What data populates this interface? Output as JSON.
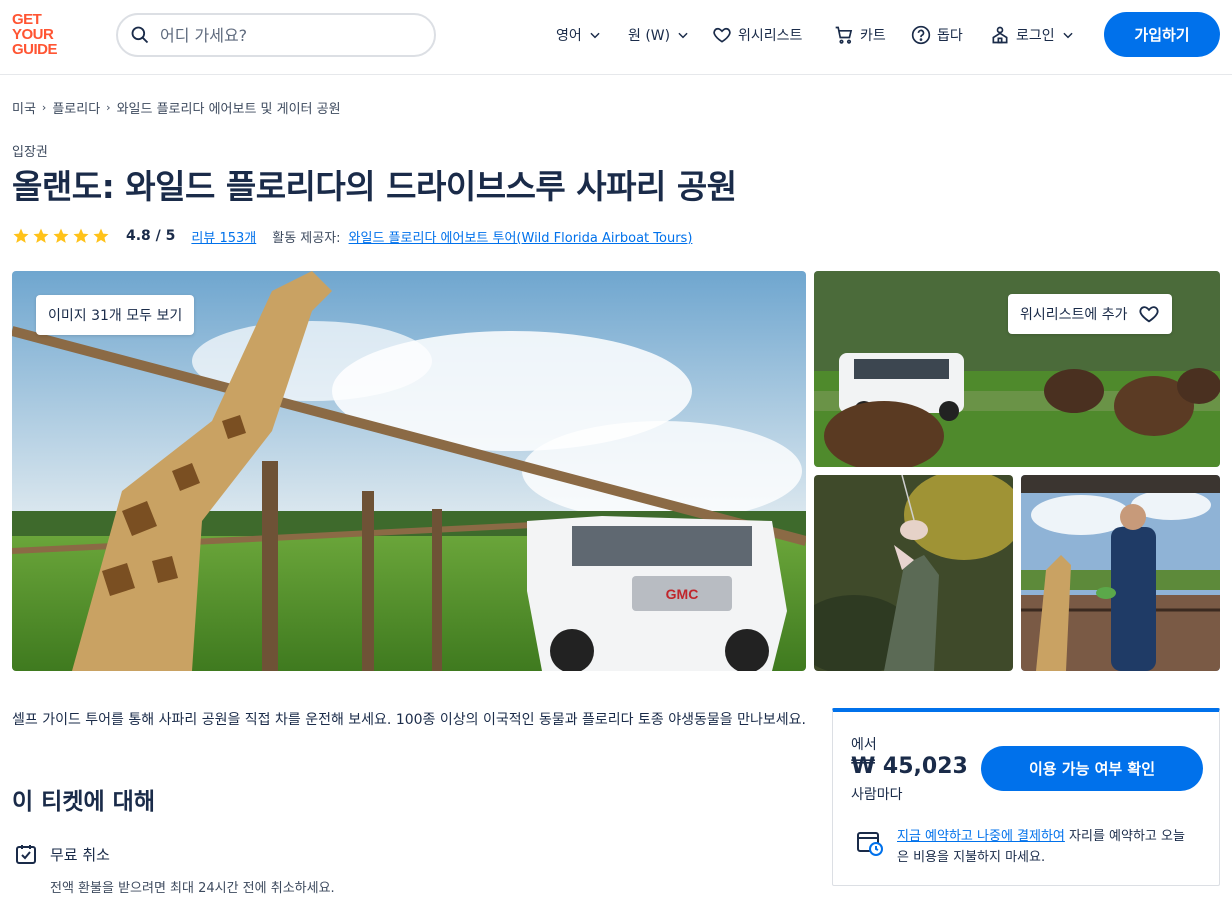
{
  "header": {
    "logo_lines": [
      "GET",
      "YOUR",
      "GUIDE"
    ],
    "search_placeholder": "어디 가세요?",
    "language": "영어",
    "currency": "원 (W)",
    "wishlist": "위시리스트",
    "cart": "카트",
    "help": "돕다",
    "login": "로그인",
    "signup": "가입하기"
  },
  "breadcrumb": [
    "미국",
    "플로리다",
    "와일드 플로리다 에어보트 및 게이터 공원"
  ],
  "product": {
    "category": "입장권",
    "title": "올랜도: 와일드 플로리다의 드라이브스루 사파리 공원",
    "rating_stars": 5,
    "rating": "4.8 / 5",
    "reviews": "리뷰 153개",
    "provider_label": "활동 제공자:",
    "provider": "와일드 플로리다 에어보트 투어(Wild Florida Airboat Tours)"
  },
  "gallery": {
    "view_all": "이미지 31개 모두 보기",
    "add_wishlist": "위시리스트에 추가"
  },
  "content": {
    "description": "셀프 가이드 투어를 통해 사파리 공원을 직접 차를 운전해 보세요. 100종 이상의 이국적인 동물과 플로리다 토종 야생동물을 만나보세요.",
    "about_heading": "이 티켓에 대해",
    "feature_title": "무료 취소",
    "feature_desc": "전액 환불을 받으려면 최대 24시간 전에 취소하세요."
  },
  "booking": {
    "from": "에서",
    "price": "₩ 45,023",
    "per": "사람마다",
    "check_button": "이용 가능 여부 확인",
    "reserve_link": "지금 예약하고 나중에 결제하여",
    "reserve_text": " 자리를 예약하고 오늘은 비용을 지불하지 마세요."
  },
  "colors": {
    "brand": "#ff5533",
    "accent": "#0071eb",
    "star": "#ffc21a",
    "text": "#1a2b49"
  }
}
